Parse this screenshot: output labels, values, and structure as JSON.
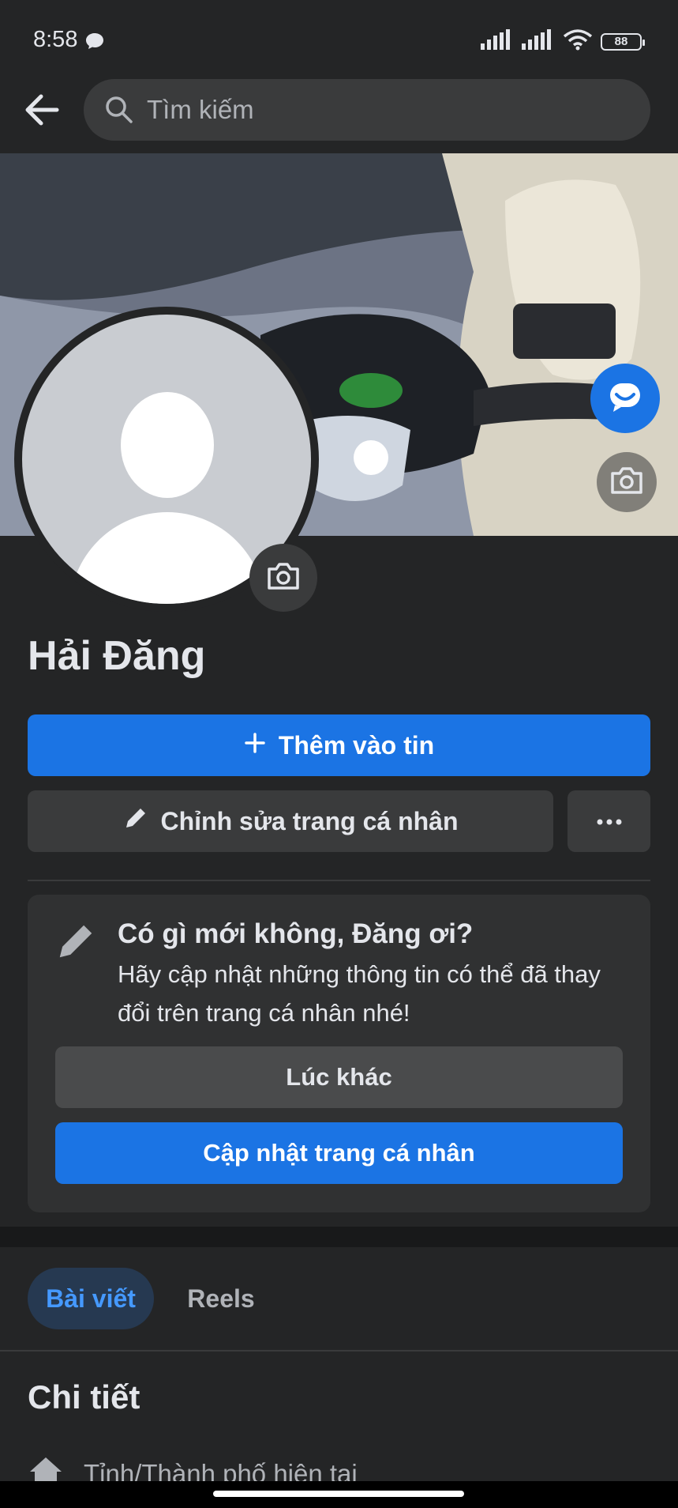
{
  "status_bar": {
    "time": "8:58",
    "battery": "88"
  },
  "search": {
    "placeholder": "Tìm kiếm"
  },
  "profile": {
    "name": "Hải Đăng"
  },
  "actions": {
    "add_story_label": "Thêm vào tin",
    "edit_profile_label": "Chỉnh sửa trang cá nhân"
  },
  "prompt_card": {
    "title": "Có gì mới không, Đăng ơi?",
    "text": "Hãy cập nhật những thông tin có thể đã thay đổi trên trang cá nhân nhé!",
    "later_label": "Lúc khác",
    "update_label": "Cập nhật trang cá nhân"
  },
  "tabs": [
    {
      "label": "Bài viết",
      "active": true
    },
    {
      "label": "Reels",
      "active": false
    }
  ],
  "details": {
    "title": "Chi tiết",
    "current_city_label": "Tỉnh/Thành phố hiện tại"
  },
  "icons": {
    "back": "arrow-left-icon",
    "search": "search-icon",
    "messenger": "messenger-icon",
    "camera": "camera-icon",
    "plus": "plus-icon",
    "pencil": "pencil-icon",
    "more": "more-dots-icon",
    "home": "home-icon"
  },
  "colors": {
    "accent": "#1b74e4",
    "background": "#242526",
    "surface": "#3a3b3c"
  }
}
